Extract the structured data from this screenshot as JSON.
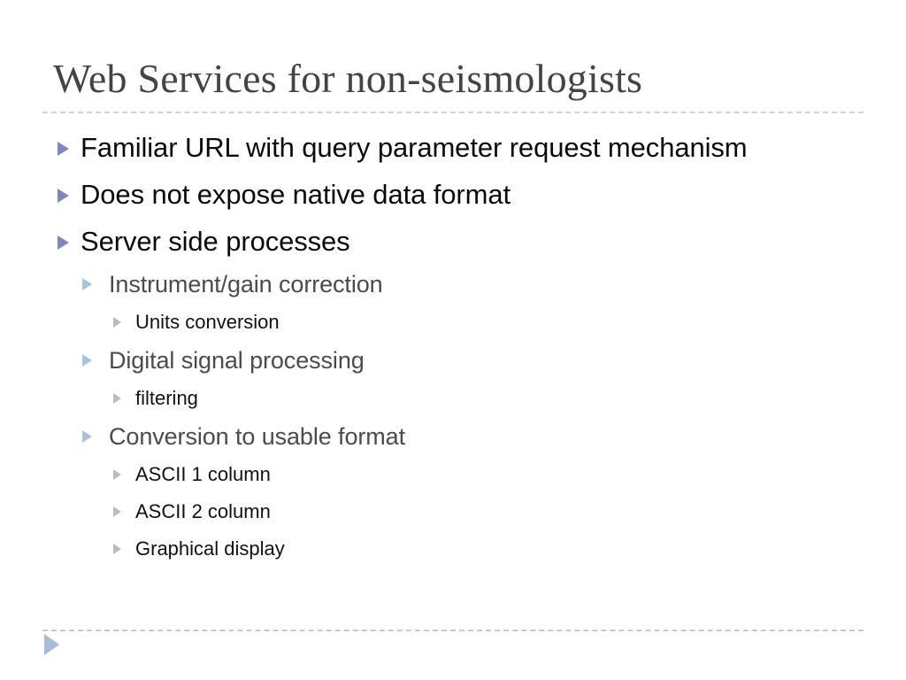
{
  "slide": {
    "title": "Web Services for non-seismologists",
    "background_color": "#ffffff",
    "title_color": "#43434c",
    "rule_color": "#d2d2d6",
    "bullets": [
      {
        "level": 1,
        "text": "Familiar URL with query parameter request mechanism",
        "marker": "triangle-right-icon",
        "marker_color": "#8287b9",
        "text_color": "#0b0b0b"
      },
      {
        "level": 1,
        "text": "Does not expose native data format",
        "marker": "triangle-right-icon",
        "marker_color": "#8287b9",
        "text_color": "#0b0b0b"
      },
      {
        "level": 1,
        "text": "Server side processes",
        "marker": "triangle-right-icon",
        "marker_color": "#8287b9",
        "text_color": "#0b0b0b"
      },
      {
        "level": 2,
        "text": "Instrument/gain correction",
        "marker": "triangle-right-icon",
        "marker_color": "#a9c2de",
        "text_color": "#4a4a53"
      },
      {
        "level": 3,
        "text": "Units conversion",
        "marker": "triangle-right-icon",
        "marker_color": "#bcbcbc",
        "text_color": "#111111"
      },
      {
        "level": 2,
        "text": "Digital signal processing",
        "marker": "triangle-right-icon",
        "marker_color": "#a9c2de",
        "text_color": "#4a4a53"
      },
      {
        "level": 3,
        "text": "filtering",
        "marker": "triangle-right-icon",
        "marker_color": "#bcbcbc",
        "text_color": "#111111"
      },
      {
        "level": 2,
        "text": "Conversion to usable format",
        "marker": "triangle-right-icon",
        "marker_color": "#a9c2de",
        "text_color": "#4a4a53"
      },
      {
        "level": 3,
        "text": "ASCII 1 column",
        "marker": "triangle-right-icon",
        "marker_color": "#bcbcbc",
        "text_color": "#111111"
      },
      {
        "level": 3,
        "text": "ASCII 2 column",
        "marker": "triangle-right-icon",
        "marker_color": "#bcbcbc",
        "text_color": "#111111"
      },
      {
        "level": 3,
        "text": "Graphical display",
        "marker": "triangle-right-icon",
        "marker_color": "#bcbcbc",
        "text_color": "#111111"
      }
    ],
    "footer": {
      "marker": "triangle-right-icon",
      "marker_color": "#a8bbd6",
      "rule_color": "#c9c9cd"
    }
  }
}
